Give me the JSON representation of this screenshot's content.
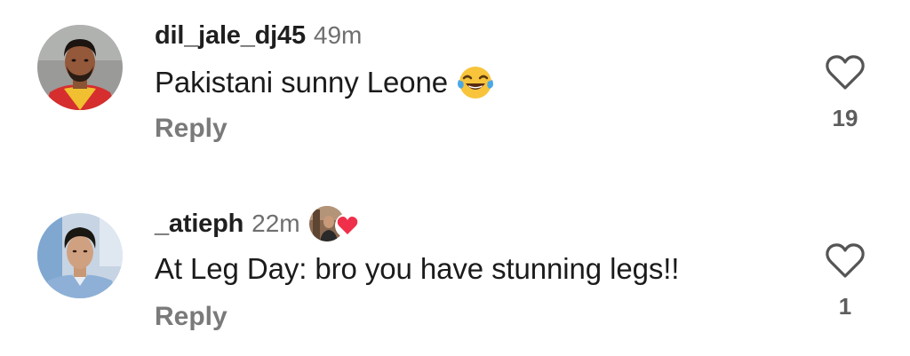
{
  "comments": [
    {
      "username": "dil_jale_dj45",
      "time": "49m",
      "text": "Pakistani sunny Leone",
      "emoji": "laughing-tears-emoji",
      "reply_label": "Reply",
      "like_count": "19",
      "liked_by_creator": false
    },
    {
      "username": "_atieph",
      "time": "22m",
      "text": "At Leg Day: bro you have stunning legs!!",
      "reply_label": "Reply",
      "like_count": "1",
      "liked_by_creator": true
    }
  ],
  "colors": {
    "username": "#1f1f1f",
    "meta": "#6f6f6f",
    "reply": "#7a7a7a",
    "heart_outline": "#555555",
    "creator_heart": "#f0304a"
  }
}
